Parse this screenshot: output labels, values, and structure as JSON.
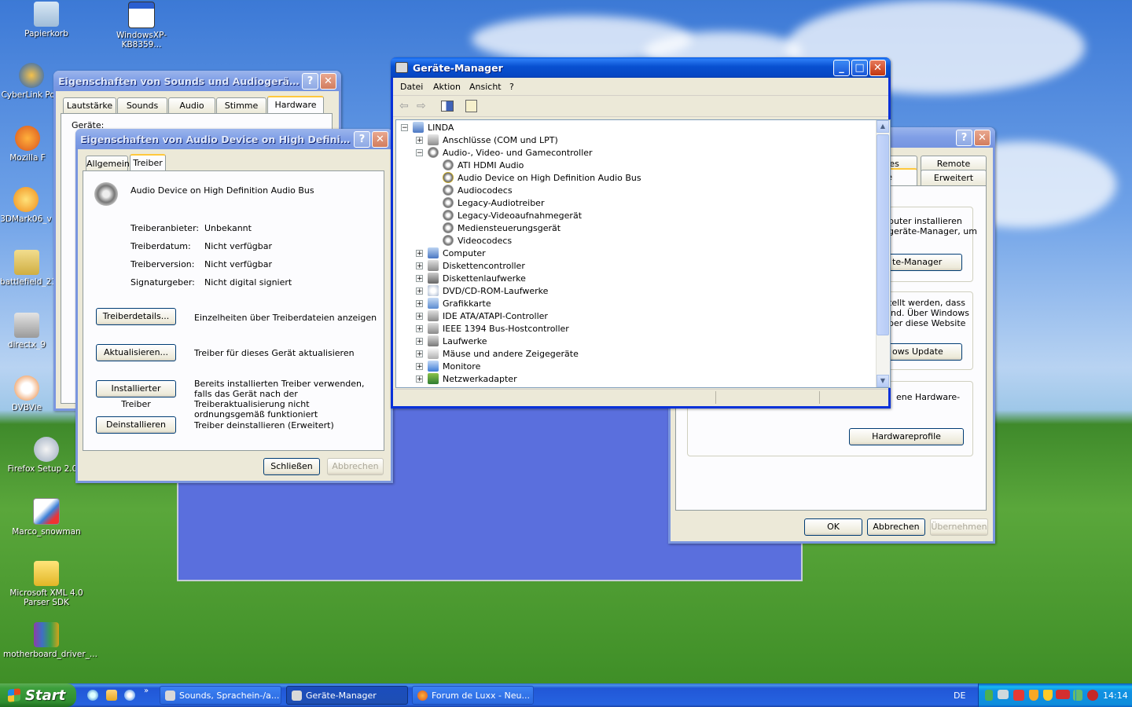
{
  "desktop": {
    "icons": [
      {
        "label": "Papierkorb"
      },
      {
        "label": "WindowsXP-KB8359..."
      },
      {
        "label": "CyberLink Pow"
      },
      {
        "label": "Mozilla F"
      },
      {
        "label": "3DMark06_v"
      },
      {
        "label": "battlefield_21"
      },
      {
        "label": "directx_9"
      },
      {
        "label": "DVBVie"
      },
      {
        "label": "Firefox Setup 2.0.0"
      },
      {
        "label": "Marco_snowman"
      },
      {
        "label": "Microsoft XML 4.0 Parser SDK"
      },
      {
        "label": "motherboard_driver_..."
      }
    ]
  },
  "sounds_window": {
    "title": "Eigenschaften von Sounds und Audiogeräte",
    "tabs": [
      "Lautstärke",
      "Sounds",
      "Audio",
      "Stimme",
      "Hardware"
    ],
    "active_tab": "Hardware",
    "partial_label": "Geräte:"
  },
  "system_window": {
    "tabs_row1": [
      "ites",
      "Remote"
    ],
    "tabs_row2": [
      "re",
      "Erweitert"
    ],
    "text1": "puter installieren\ngeräte-Manager, um",
    "btn_devmgr": "te-Manager",
    "text2": "tellt werden, dass\nind. Über Windows\nber diese Website",
    "btn_update": "ows Update",
    "text3": "ene Hardware-",
    "btn_profiles": "Hardwareprofile",
    "ok": "OK",
    "cancel": "Abbrechen",
    "apply": "Übernehmen"
  },
  "driver_window": {
    "title": "Eigenschaften von Audio Device on High Definition Au...",
    "tabs": [
      "Allgemein",
      "Treiber"
    ],
    "active_tab": "Treiber",
    "device_name": "Audio Device on High Definition Audio Bus",
    "fields": [
      {
        "label": "Treiberanbieter:",
        "value": "Unbekannt"
      },
      {
        "label": "Treiberdatum:",
        "value": "Nicht verfügbar"
      },
      {
        "label": "Treiberversion:",
        "value": "Nicht verfügbar"
      },
      {
        "label": "Signaturgeber:",
        "value": "Nicht digital signiert"
      }
    ],
    "actions": [
      {
        "button": "Treiberdetails...",
        "desc": "Einzelheiten über Treiberdateien anzeigen"
      },
      {
        "button": "Aktualisieren...",
        "desc": "Treiber für dieses Gerät aktualisieren"
      },
      {
        "button": "Installierter Treiber",
        "desc": "Bereits installierten Treiber verwenden, falls das Gerät nach der Treiberaktualisierung nicht ordnungsgemäß funktioniert"
      },
      {
        "button": "Deinstallieren",
        "desc": "Treiber deinstallieren (Erweitert)"
      }
    ],
    "close": "Schließen",
    "cancel": "Abbrechen"
  },
  "devmgr": {
    "title": "Geräte-Manager",
    "menu": [
      "Datei",
      "Aktion",
      "Ansicht",
      "?"
    ],
    "tree": [
      {
        "label": "LINDA",
        "level": 0,
        "exp": "−",
        "icon": "computer-icon"
      },
      {
        "label": "Anschlüsse (COM und LPT)",
        "level": 1,
        "exp": "+",
        "icon": "port-icon"
      },
      {
        "label": "Audio-, Video- und Gamecontroller",
        "level": 1,
        "exp": "−",
        "icon": "speaker-icon"
      },
      {
        "label": "ATI HDMI Audio",
        "level": 2,
        "exp": "",
        "icon": "speaker-icon"
      },
      {
        "label": "Audio Device on High Definition Audio Bus",
        "level": 2,
        "exp": "",
        "icon": "warning-speaker-icon"
      },
      {
        "label": "Audiocodecs",
        "level": 2,
        "exp": "",
        "icon": "speaker-icon"
      },
      {
        "label": "Legacy-Audiotreiber",
        "level": 2,
        "exp": "",
        "icon": "speaker-icon"
      },
      {
        "label": "Legacy-Videoaufnahmegerät",
        "level": 2,
        "exp": "",
        "icon": "speaker-icon"
      },
      {
        "label": "Mediensteuerungsgerät",
        "level": 2,
        "exp": "",
        "icon": "speaker-icon"
      },
      {
        "label": "Videocodecs",
        "level": 2,
        "exp": "",
        "icon": "speaker-icon"
      },
      {
        "label": "Computer",
        "level": 1,
        "exp": "+",
        "icon": "computer-icon"
      },
      {
        "label": "Diskettencontroller",
        "level": 1,
        "exp": "+",
        "icon": "controller-icon"
      },
      {
        "label": "Diskettenlaufwerke",
        "level": 1,
        "exp": "+",
        "icon": "floppy-icon"
      },
      {
        "label": "DVD/CD-ROM-Laufwerke",
        "level": 1,
        "exp": "+",
        "icon": "cdrom-icon"
      },
      {
        "label": "Grafikkarte",
        "level": 1,
        "exp": "+",
        "icon": "display-icon"
      },
      {
        "label": "IDE ATA/ATAPI-Controller",
        "level": 1,
        "exp": "+",
        "icon": "controller-icon"
      },
      {
        "label": "IEEE 1394 Bus-Hostcontroller",
        "level": 1,
        "exp": "+",
        "icon": "controller-icon"
      },
      {
        "label": "Laufwerke",
        "level": 1,
        "exp": "+",
        "icon": "drive-icon"
      },
      {
        "label": "Mäuse und andere Zeigegeräte",
        "level": 1,
        "exp": "+",
        "icon": "mouse-icon"
      },
      {
        "label": "Monitore",
        "level": 1,
        "exp": "+",
        "icon": "monitor-icon"
      },
      {
        "label": "Netzwerkadapter",
        "level": 1,
        "exp": "+",
        "icon": "network-icon"
      }
    ]
  },
  "taskbar": {
    "start": "Start",
    "tasks": [
      {
        "label": "Sounds, Sprachein-/a..."
      },
      {
        "label": "Geräte-Manager"
      },
      {
        "label": "Forum de Luxx - Neu..."
      }
    ],
    "language": "DE",
    "clock": "14:14"
  }
}
